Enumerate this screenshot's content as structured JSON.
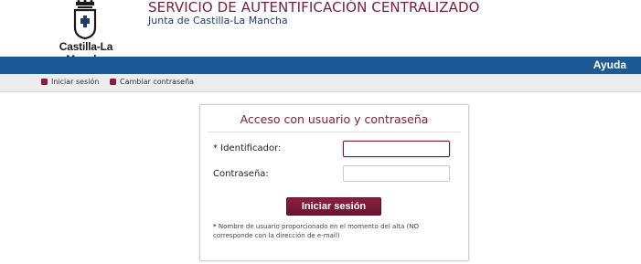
{
  "header": {
    "title": "SERVICIO DE AUTENTIFICACIÓN CENTRALIZADO",
    "subtitle": "Junta de Castilla-La Mancha",
    "logo_text": "Castilla-La Mancha"
  },
  "topbar": {
    "help_label": "Ayuda",
    "color": "#1c5a96"
  },
  "nav": {
    "items": [
      {
        "label": "Iniciar sesión"
      },
      {
        "label": "Cambiar contraseña"
      }
    ],
    "bullet_color": "#8c1b3d"
  },
  "login": {
    "title": "Acceso con usuario y contraseña",
    "username_label": "* Identificador:",
    "username_value": "",
    "password_label": "Contraseña:",
    "password_value": "",
    "submit_label": "Iniciar sesión",
    "note_star": "*",
    "note_text": " Nombre de usuario proporcionado en el momento del alta (NO corresponde con la dirección de e-mail)"
  },
  "colors": {
    "brand": "#7a1d3c",
    "button": "#7a1d3c"
  }
}
